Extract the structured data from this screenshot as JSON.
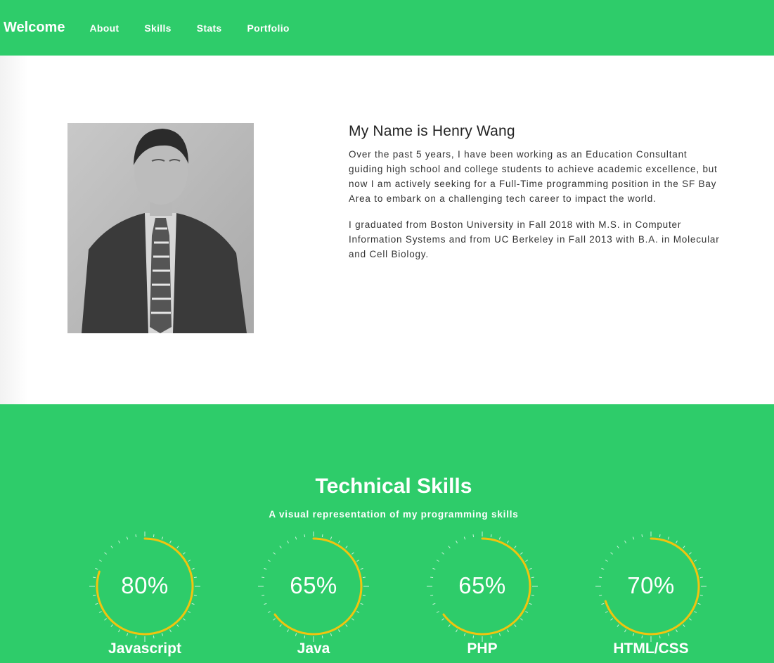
{
  "nav": {
    "brand": "Welcome",
    "links": [
      "About",
      "Skills",
      "Stats",
      "Portfolio"
    ]
  },
  "about": {
    "name": "My Name is Henry Wang",
    "para1": "Over the past 5 years, I have been working as an Education Consultant guiding high school and college students to achieve academic excellence, but now I am actively seeking for a Full-Time programming position in the SF Bay Area to embark on a challenging tech career to impact the world.",
    "para2": "I graduated from Boston University in Fall 2018 with M.S. in Computer Information Systems and from UC Berkeley in Fall 2013 with B.A. in Molecular and Cell Biology."
  },
  "skills": {
    "title": "Technical Skills",
    "subtitle": "A visual representation of my programming skills",
    "items": [
      {
        "name": "Javascript",
        "percent_label": "80%",
        "percent": 80
      },
      {
        "name": "Java",
        "percent_label": "65%",
        "percent": 65
      },
      {
        "name": "PHP",
        "percent_label": "65%",
        "percent": 65
      },
      {
        "name": "HTML/CSS",
        "percent_label": "70%",
        "percent": 70
      }
    ]
  },
  "colors": {
    "brand_green": "#2ecc6a",
    "ring_yellow": "#f1c40f",
    "text_dark": "#333333"
  }
}
